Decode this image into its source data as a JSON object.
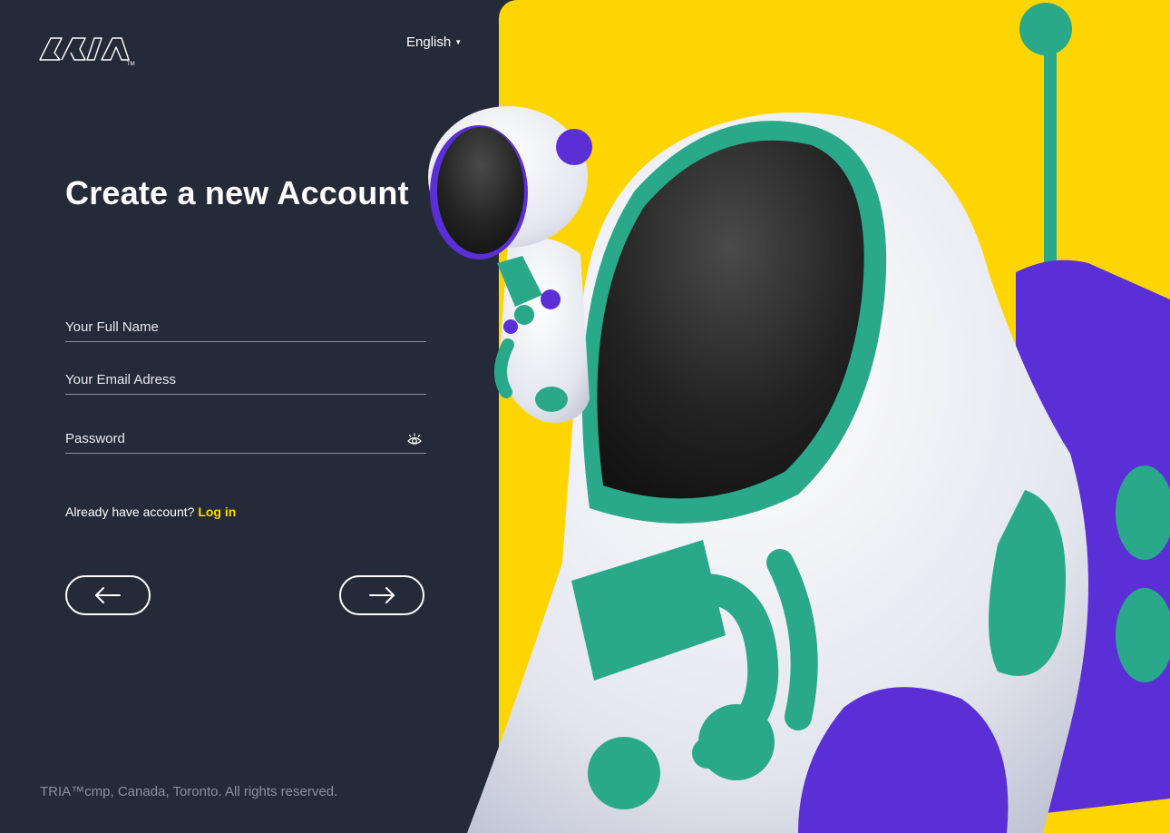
{
  "brand": {
    "logo_alt": "TRIA",
    "trademark": "TM"
  },
  "language": {
    "selected": "English"
  },
  "page": {
    "title": "Create a new Account"
  },
  "form": {
    "full_name_placeholder": "Your Full Name",
    "email_placeholder": "Your Email Adress",
    "password_placeholder": "Password"
  },
  "login_prompt": {
    "text": "Already have account?",
    "link": "Log in"
  },
  "nav": {
    "back_icon": "arrow-left-icon",
    "next_icon": "arrow-right-icon"
  },
  "footer": {
    "text": "TRIA™cmp, Canada,  Toronto. All rights reserved."
  },
  "colors": {
    "background": "#252a39",
    "accent": "#ffd500",
    "teal": "#2aa98a",
    "purple": "#5a2fd6"
  }
}
